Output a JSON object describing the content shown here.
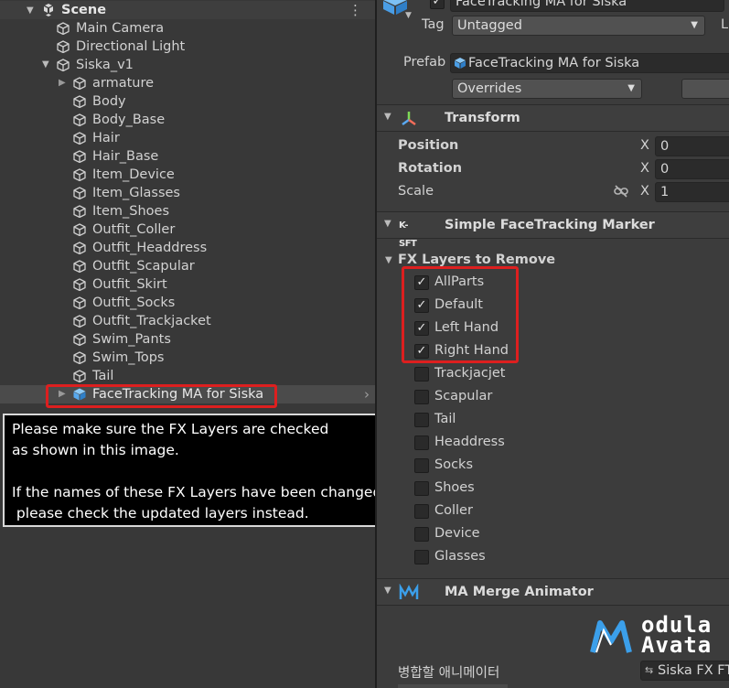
{
  "hierarchy": {
    "scene_label": "Scene",
    "menu_glyph": "⋮",
    "items": [
      {
        "label": "Main Camera"
      },
      {
        "label": "Directional Light"
      },
      {
        "label": "Siska_v1"
      },
      {
        "label": "armature"
      },
      {
        "label": "Body"
      },
      {
        "label": "Body_Base"
      },
      {
        "label": "Hair"
      },
      {
        "label": "Hair_Base"
      },
      {
        "label": "Item_Device"
      },
      {
        "label": "Item_Glasses"
      },
      {
        "label": "Item_Shoes"
      },
      {
        "label": "Outfit_Coller"
      },
      {
        "label": "Outfit_Headdress"
      },
      {
        "label": "Outfit_Scapular"
      },
      {
        "label": "Outfit_Skirt"
      },
      {
        "label": "Outfit_Socks"
      },
      {
        "label": "Outfit_Trackjacket"
      },
      {
        "label": "Swim_Pants"
      },
      {
        "label": "Swim_Tops"
      },
      {
        "label": "Tail"
      },
      {
        "label": "FaceTracking MA for Siska"
      }
    ]
  },
  "note": {
    "line1": "Please make sure the FX Layers are checked",
    "line2": "as shown in this image.",
    "line3": "If the names of these FX Layers have been changed,",
    "line4": " please check the updated layers instead."
  },
  "inspector": {
    "object_name": "FaceTracking MA for Siska",
    "tag_label": "Tag",
    "tag_value": "Untagged",
    "layer_label_partial": "L",
    "prefab_label": "Prefab",
    "prefab_value": "FaceTracking MA for Siska",
    "overrides_label": "Overrides",
    "transform": {
      "title": "Transform",
      "position_label": "Position",
      "rotation_label": "Rotation",
      "scale_label": "Scale",
      "axis_x": "X",
      "position_x": "0",
      "rotation_x": "0",
      "scale_x": "1"
    },
    "marker": {
      "title": "Simple FaceTracking Marker",
      "icon_text": "K-SFT",
      "fx_section_label": "FX Layers to Remove",
      "layers": [
        {
          "label": "AllParts",
          "checked": true
        },
        {
          "label": "Default",
          "checked": true
        },
        {
          "label": "Left Hand",
          "checked": true
        },
        {
          "label": "Right Hand",
          "checked": true
        },
        {
          "label": "Trackjacjet",
          "checked": false
        },
        {
          "label": "Scapular",
          "checked": false
        },
        {
          "label": "Tail",
          "checked": false
        },
        {
          "label": "Headdress",
          "checked": false
        },
        {
          "label": "Socks",
          "checked": false
        },
        {
          "label": "Shoes",
          "checked": false
        },
        {
          "label": "Coller",
          "checked": false
        },
        {
          "label": "Device",
          "checked": false
        },
        {
          "label": "Glasses",
          "checked": false
        }
      ]
    },
    "merge_animator": {
      "title": "MA Merge Animator",
      "logo_line1": "odula",
      "logo_line2": "Avata",
      "animator_label": "병합할 애니메이터",
      "animator_value": "Siska FX FT"
    }
  },
  "colors": {
    "accent_red": "#dd1f1f",
    "cube_blue": "#58a9ee",
    "logo_blue": "#3b9fea"
  }
}
